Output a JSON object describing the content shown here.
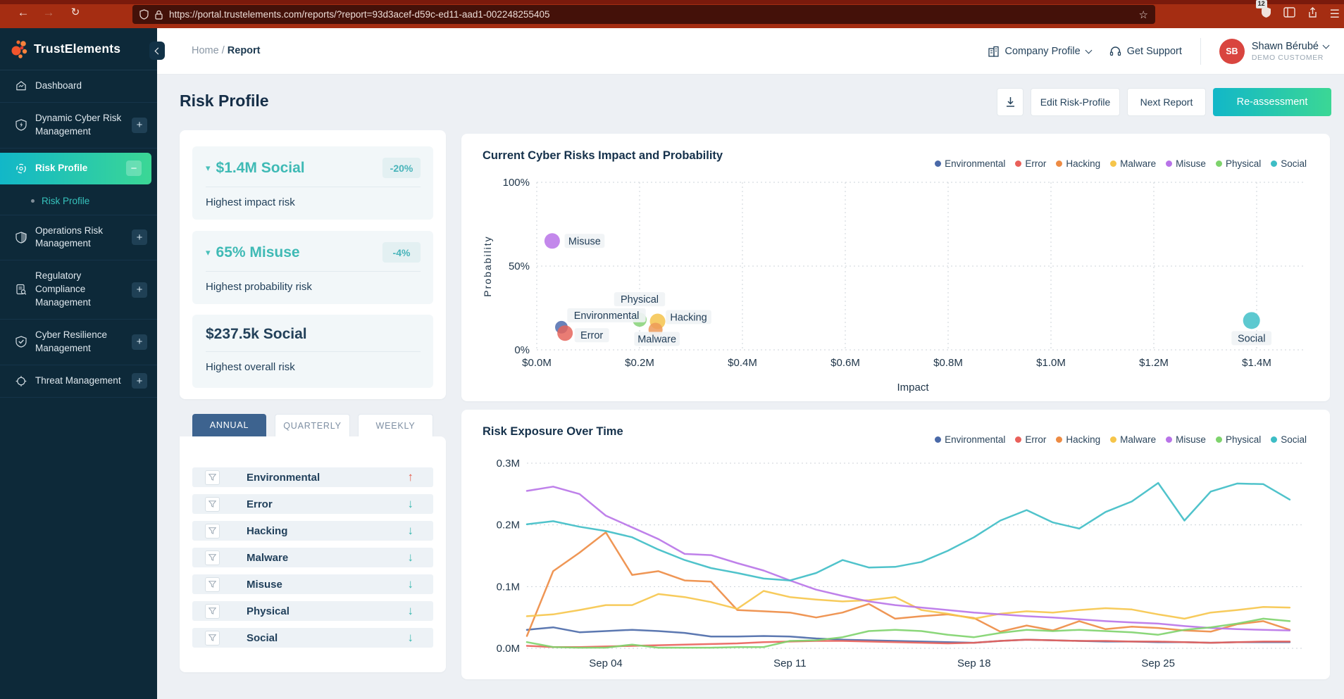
{
  "theme": {
    "chrome": "#a52d12",
    "chrome_dark": "#7a1a0c",
    "urlbar": "#441109",
    "sidebar": "#0d2939",
    "grad_a": "#12b7c8",
    "grad_b": "#3bd795",
    "tab_active": "#3d638f",
    "avatar": "#d9453f"
  },
  "browser": {
    "url": "https://portal.trustelements.com/reports/?report=93d3acef-d59c-ed11-aad1-002248255405",
    "extension_badge": "12"
  },
  "sidebar": {
    "brand": "TrustElements",
    "items": [
      {
        "label": "Dashboard"
      },
      {
        "label": "Dynamic Cyber Risk Management",
        "action": "+"
      },
      {
        "label": "Risk Profile",
        "action": "−",
        "active": true
      },
      {
        "label": "Risk Profile",
        "type": "sub"
      },
      {
        "label": "Operations Risk Management",
        "action": "+"
      },
      {
        "label": "Regulatory Compliance Management",
        "action": "+"
      },
      {
        "label": "Cyber Resilience Management",
        "action": "+"
      },
      {
        "label": "Threat Management",
        "action": "+"
      }
    ]
  },
  "header": {
    "breadcrumb_home": "Home",
    "breadcrumb_sep": "/",
    "breadcrumb_current": "Report",
    "company_profile": "Company Profile",
    "get_support": "Get Support",
    "user": {
      "initials": "SB",
      "name": "Shawn Bérubé",
      "role": "DEMO CUSTOMER"
    }
  },
  "toolbar": {
    "title": "Risk Profile",
    "edit_label": "Edit Risk-Profile",
    "next_label": "Next Report",
    "reassess_label": "Re-assessment"
  },
  "stats": [
    {
      "value": "$1.4M Social",
      "badge": "-20%",
      "caption": "Highest impact risk",
      "trend": "down"
    },
    {
      "value": "65% Misuse",
      "badge": "-4%",
      "caption": "Highest probability risk",
      "trend": "down"
    },
    {
      "value": "$237.5k Social",
      "caption": "Highest overall risk"
    }
  ],
  "tabs": [
    {
      "label": "ANNUAL",
      "active": true
    },
    {
      "label": "QUARTERLY",
      "active": false
    },
    {
      "label": "WEEKLY",
      "active": false
    }
  ],
  "risk_list": [
    {
      "label": "Environmental",
      "direction": "up"
    },
    {
      "label": "Error",
      "direction": "down"
    },
    {
      "label": "Hacking",
      "direction": "down"
    },
    {
      "label": "Malware",
      "direction": "down"
    },
    {
      "label": "Misuse",
      "direction": "down"
    },
    {
      "label": "Physical",
      "direction": "down"
    },
    {
      "label": "Social",
      "direction": "down"
    }
  ],
  "legend_order": [
    "Environmental",
    "Error",
    "Hacking",
    "Malware",
    "Misuse",
    "Physical",
    "Social"
  ],
  "palette": {
    "Environmental": "#4a69a8",
    "Error": "#e9605a",
    "Hacking": "#ed8b43",
    "Malware": "#f6c54a",
    "Misuse": "#b873e8",
    "Physical": "#7ed36c",
    "Social": "#3dbdc5"
  },
  "chart_data": [
    {
      "type": "scatter",
      "title": "Current Cyber Risks Impact and Probability",
      "xlabel": "Impact",
      "ylabel": "Probability",
      "xlim": [
        0,
        1.4
      ],
      "ylim": [
        0,
        100
      ],
      "x_ticks": [
        {
          "value": 0.0,
          "label": "$0.0M"
        },
        {
          "value": 0.2,
          "label": "$0.2M"
        },
        {
          "value": 0.4,
          "label": "$0.4M"
        },
        {
          "value": 0.6,
          "label": "$0.6M"
        },
        {
          "value": 0.8,
          "label": "$0.8M"
        },
        {
          "value": 1.0,
          "label": "$1.0M"
        },
        {
          "value": 1.2,
          "label": "$1.2M"
        },
        {
          "value": 1.4,
          "label": "$1.4M"
        }
      ],
      "y_ticks": [
        {
          "value": 0,
          "label": "0%"
        },
        {
          "value": 50,
          "label": "50%"
        },
        {
          "value": 100,
          "label": "100%"
        }
      ],
      "points": [
        {
          "name": "Misuse",
          "impact_m": 0.03,
          "probability_pct": 65,
          "color": "#b873e8",
          "r": 11,
          "label_dx": 46,
          "label_dy": 0
        },
        {
          "name": "Environmental",
          "impact_m": 0.048,
          "probability_pct": 13.5,
          "color": "#4f6cae",
          "r": 9,
          "label_dx": 64,
          "label_dy": -17
        },
        {
          "name": "Error",
          "impact_m": 0.055,
          "probability_pct": 10,
          "color": "#e5655c",
          "r": 11,
          "label_dx": 38,
          "label_dy": 3
        },
        {
          "name": "Physical",
          "impact_m": 0.2,
          "probability_pct": 18,
          "color": "#86d277",
          "r": 10,
          "label_dx": 0,
          "label_dy": -29
        },
        {
          "name": "Hacking",
          "impact_m": 0.235,
          "probability_pct": 17,
          "color": "#f5c34c",
          "r": 11,
          "label_dx": 44,
          "label_dy": -6
        },
        {
          "name": "Malware",
          "impact_m": 0.231,
          "probability_pct": 12,
          "color": "#ed9a58",
          "r": 10,
          "label_dx": 2,
          "label_dy": 13
        },
        {
          "name": "Social",
          "impact_m": 1.39,
          "probability_pct": 17.5,
          "color": "#41bfc8",
          "r": 12,
          "label_dx": 0,
          "label_dy": 25
        }
      ]
    },
    {
      "type": "line",
      "title": "Risk Exposure Over Time",
      "ylim": [
        0,
        0.3
      ],
      "n_points": 30,
      "x_ticks": [
        {
          "index": 3,
          "label": "Sep 04"
        },
        {
          "index": 10,
          "label": "Sep 11"
        },
        {
          "index": 17,
          "label": "Sep 18"
        },
        {
          "index": 24,
          "label": "Sep 25"
        }
      ],
      "y_ticks": [
        {
          "value": 0.0,
          "label": "0.0M"
        },
        {
          "value": 0.1,
          "label": "0.1M"
        },
        {
          "value": 0.2,
          "label": "0.2M"
        },
        {
          "value": 0.3,
          "label": "0.3M"
        }
      ],
      "series": [
        {
          "name": "Environmental",
          "values": [
            0.03,
            0.034,
            0.026,
            0.028,
            0.03,
            0.028,
            0.025,
            0.019,
            0.019,
            0.02,
            0.019,
            0.016,
            0.014,
            0.013,
            0.012,
            0.011,
            0.01,
            0.009,
            0.012,
            0.014,
            0.013,
            0.012,
            0.011,
            0.011,
            0.01,
            0.01,
            0.009,
            0.01,
            0.01,
            0.01
          ]
        },
        {
          "name": "Error",
          "values": [
            0.004,
            0.002,
            0.002,
            0.003,
            0.004,
            0.005,
            0.006,
            0.007,
            0.008,
            0.01,
            0.011,
            0.012,
            0.012,
            0.011,
            0.01,
            0.009,
            0.008,
            0.009,
            0.012,
            0.014,
            0.013,
            0.012,
            0.012,
            0.011,
            0.011,
            0.01,
            0.009,
            0.01,
            0.011,
            0.011
          ]
        },
        {
          "name": "Hacking",
          "values": [
            0.02,
            0.125,
            0.155,
            0.188,
            0.119,
            0.125,
            0.11,
            0.108,
            0.062,
            0.06,
            0.058,
            0.05,
            0.058,
            0.072,
            0.048,
            0.052,
            0.055,
            0.049,
            0.027,
            0.037,
            0.029,
            0.044,
            0.031,
            0.035,
            0.033,
            0.029,
            0.027,
            0.039,
            0.044,
            0.03
          ]
        },
        {
          "name": "Malware",
          "values": [
            0.052,
            0.055,
            0.062,
            0.07,
            0.07,
            0.088,
            0.083,
            0.075,
            0.064,
            0.093,
            0.083,
            0.079,
            0.076,
            0.078,
            0.083,
            0.062,
            0.056,
            0.048,
            0.056,
            0.06,
            0.058,
            0.062,
            0.065,
            0.063,
            0.055,
            0.048,
            0.058,
            0.062,
            0.067,
            0.066
          ]
        },
        {
          "name": "Misuse",
          "values": [
            0.255,
            0.262,
            0.25,
            0.215,
            0.196,
            0.177,
            0.153,
            0.151,
            0.138,
            0.126,
            0.11,
            0.095,
            0.085,
            0.076,
            0.07,
            0.066,
            0.062,
            0.058,
            0.055,
            0.052,
            0.05,
            0.047,
            0.044,
            0.042,
            0.04,
            0.036,
            0.033,
            0.031,
            0.03,
            0.029
          ]
        },
        {
          "name": "Physical",
          "values": [
            0.01,
            0.002,
            0.001,
            0.001,
            0.006,
            0.001,
            0.001,
            0.001,
            0.002,
            0.002,
            0.012,
            0.013,
            0.018,
            0.028,
            0.03,
            0.028,
            0.022,
            0.018,
            0.025,
            0.03,
            0.028,
            0.03,
            0.028,
            0.026,
            0.022,
            0.03,
            0.034,
            0.04,
            0.048,
            0.044
          ]
        },
        {
          "name": "Social",
          "values": [
            0.201,
            0.206,
            0.197,
            0.19,
            0.18,
            0.16,
            0.143,
            0.13,
            0.122,
            0.113,
            0.11,
            0.122,
            0.143,
            0.131,
            0.132,
            0.14,
            0.158,
            0.18,
            0.207,
            0.224,
            0.204,
            0.194,
            0.221,
            0.238,
            0.268,
            0.207,
            0.254,
            0.267,
            0.266,
            0.241
          ]
        }
      ]
    }
  ]
}
